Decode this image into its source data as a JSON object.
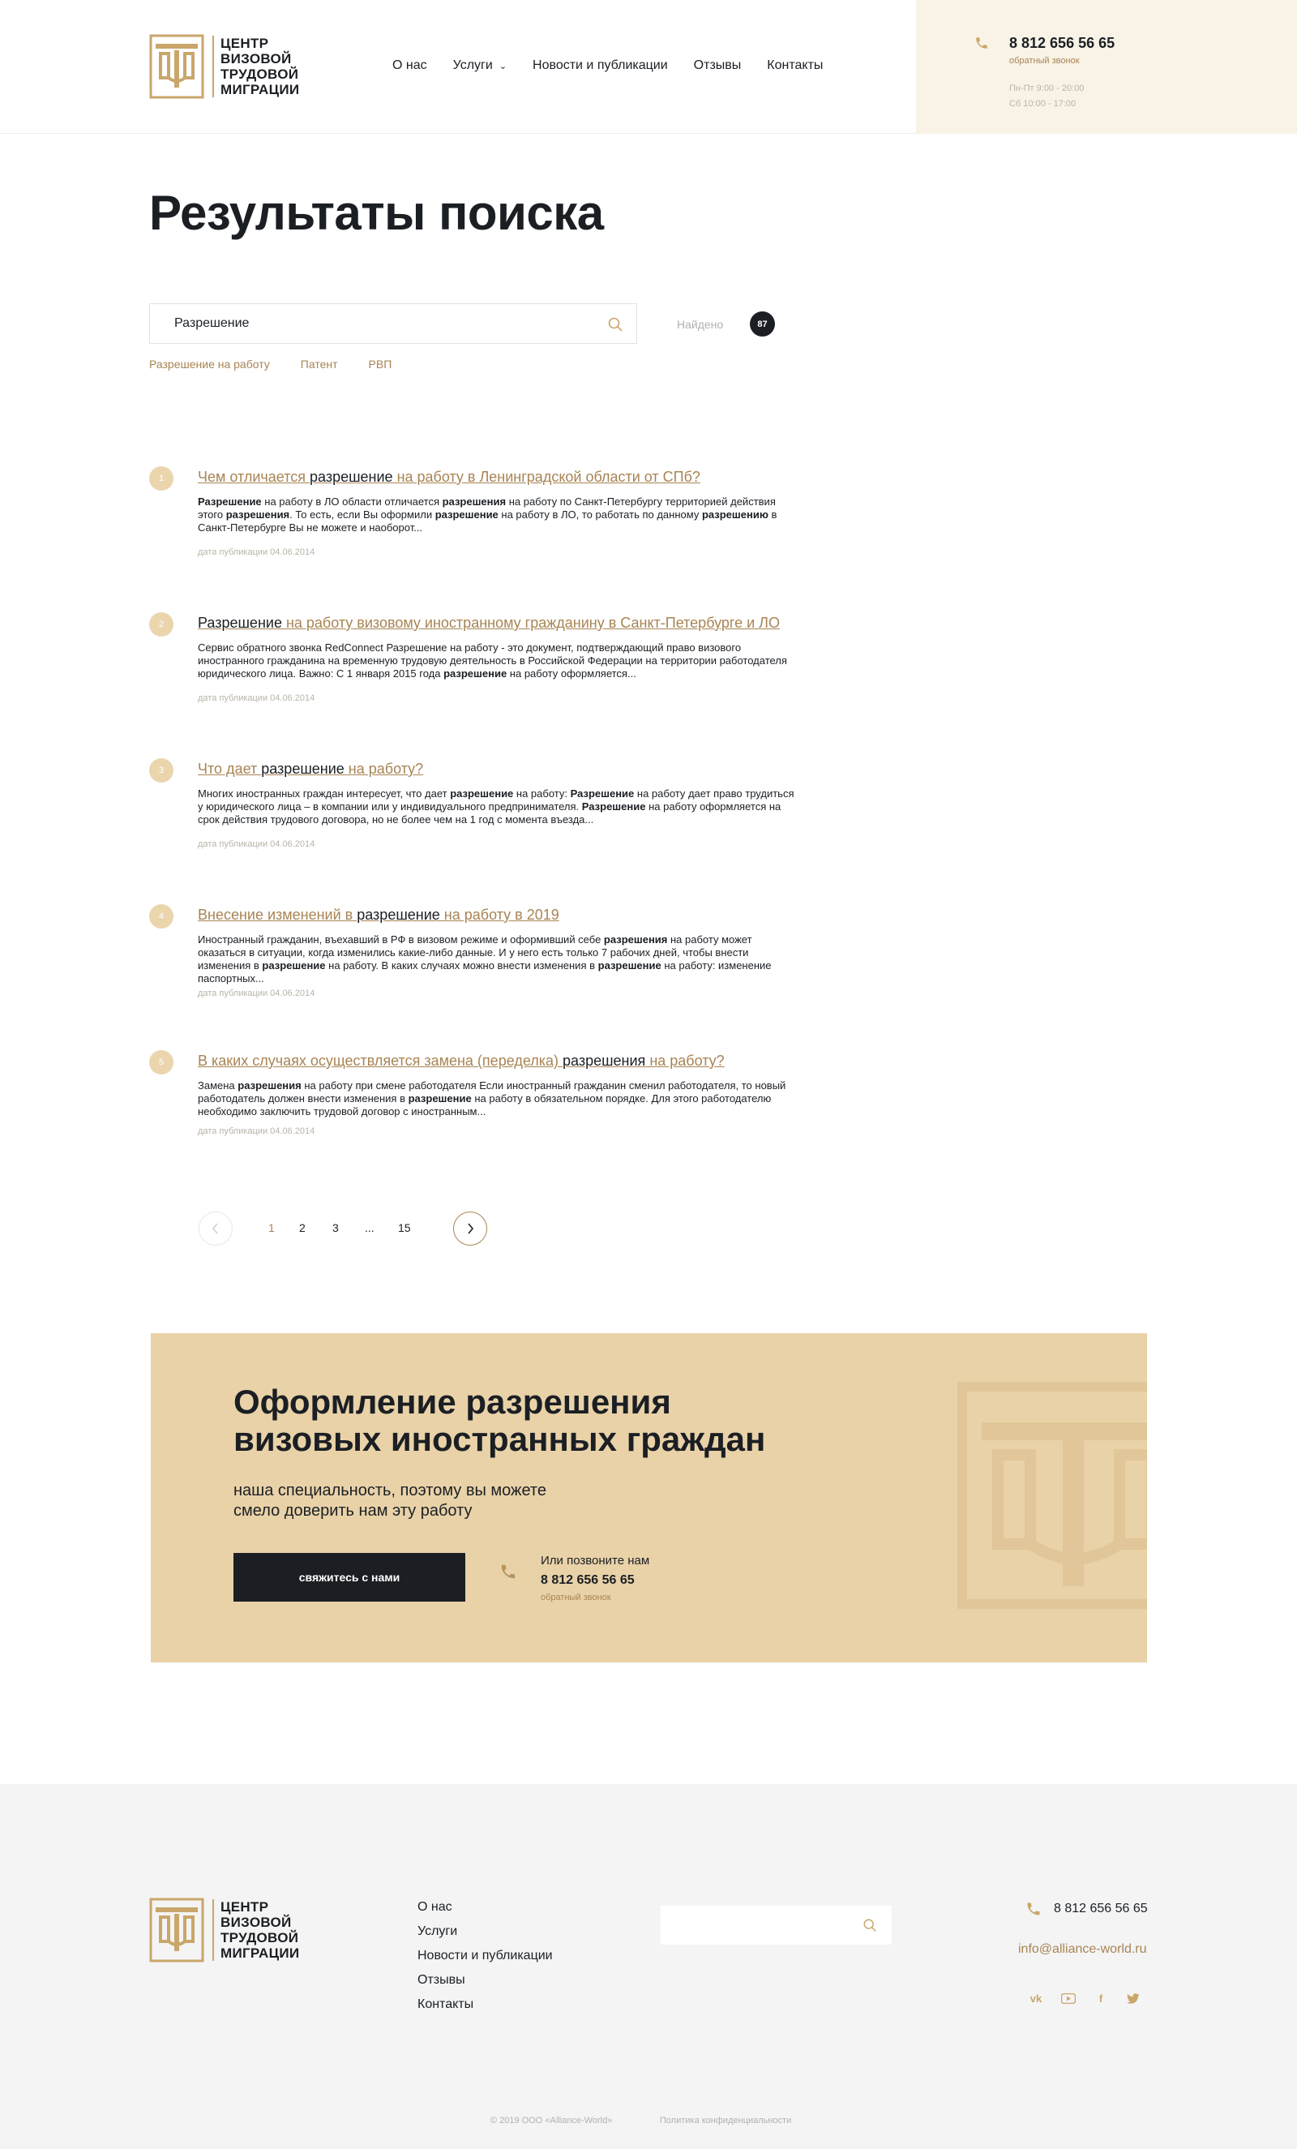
{
  "header": {
    "logo_lines": [
      "ЦЕНТР",
      "ВИЗОВОЙ",
      "ТРУДОВОЙ",
      "МИГРАЦИИ"
    ],
    "nav": [
      "О нас",
      "Услуги",
      "Новости и публикации",
      "Отзывы",
      "Контакты"
    ],
    "phone": "8 812 656 56 65",
    "callback": "обратный звонок",
    "hours": [
      "Пн-Пт 9:00 - 20:00",
      "Сб 10:00 - 17:00"
    ]
  },
  "page_title": "Результаты поиска",
  "search": {
    "value": "Разрешение",
    "found_label": "Найдено",
    "found_count": "87",
    "tags": [
      "Разрешение на работу",
      "Патент",
      "РВП"
    ]
  },
  "results": [
    {
      "num": "1",
      "title": [
        [
          "Чем отличается ",
          false
        ],
        [
          "разрешение",
          true
        ],
        [
          " на работу в Ленинградской области от СПб?",
          false
        ]
      ],
      "text": [
        [
          "Разрешение",
          true
        ],
        [
          " на работу в ЛО области отличается ",
          false
        ],
        [
          "разрешения",
          true
        ],
        [
          " на работу по Санкт-Петербургу территорией действия этого ",
          false
        ],
        [
          "разрешения",
          true
        ],
        [
          ". То есть, если Вы оформили ",
          false
        ],
        [
          "разрешение",
          true
        ],
        [
          " на работу в ЛО, то работать по данному ",
          false
        ],
        [
          "разрешению",
          true
        ],
        [
          " в Санкт-Петербурге Вы не можете и наоборот...",
          false
        ]
      ],
      "date": "дата публикации 04.06.2014"
    },
    {
      "num": "2",
      "title": [
        [
          "Разрешение",
          true
        ],
        [
          " на работу визовому иностранному гражданину в Санкт-Петербурге и ЛО",
          false
        ]
      ],
      "text": [
        [
          "Сервис обратного звонка RedConnect Разрешение на работу - это документ, подтверждающий право визового иностранного гражданина на временную трудовую деятельность в Российской Федерации на территории работодателя юридического лица. Важно: С 1 января 2015 года ",
          false
        ],
        [
          "разрешение",
          true
        ],
        [
          " на работу оформляется...",
          false
        ]
      ],
      "date": "дата публикации 04.06.2014"
    },
    {
      "num": "3",
      "title": [
        [
          "Что дает ",
          false
        ],
        [
          "разрешение",
          true
        ],
        [
          " на работу?",
          false
        ]
      ],
      "text": [
        [
          "Многих иностранных граждан интересует, что дает ",
          false
        ],
        [
          "разрешение",
          true
        ],
        [
          " на работу: ",
          false
        ],
        [
          "Разрешение",
          true
        ],
        [
          " на работу дает право трудиться у юридического лица – в компании или у индивидуального предпринимателя. ",
          false
        ],
        [
          "Разрешение",
          true
        ],
        [
          " на работу оформляется на срок действия трудового договора, но не более чем на 1 год с момента въезда...",
          false
        ]
      ],
      "date": "дата публикации 04.06.2014"
    },
    {
      "num": "4",
      "title": [
        [
          "Внесение изменений в ",
          false
        ],
        [
          "разрешение",
          true
        ],
        [
          " на работу в 2019",
          false
        ]
      ],
      "text": [
        [
          "Иностранный гражданин, въехавший в РФ в визовом режиме и оформивший себе ",
          false
        ],
        [
          "разрешения",
          true
        ],
        [
          " на работу может оказаться в ситуации, когда изменились какие-либо данные. И у него есть только 7 рабочих дней, чтобы внести изменения в ",
          false
        ],
        [
          "разрешение",
          true
        ],
        [
          " на работу. В каких случаях можно внести изменения в ",
          false
        ],
        [
          "разрешение",
          true
        ],
        [
          " на работу: изменение паспортных...",
          false
        ]
      ],
      "date": "дата публикации 04.06.2014"
    },
    {
      "num": "5",
      "title": [
        [
          "В каких случаях осуществляется замена (переделка) ",
          false
        ],
        [
          "разрешения",
          true
        ],
        [
          " на работу?",
          false
        ]
      ],
      "text": [
        [
          "Замена ",
          false
        ],
        [
          "разрешения",
          true
        ],
        [
          " на работу при смене работодателя Если иностранный гражданин сменил работодателя, то новый работодатель должен внести изменения в ",
          false
        ],
        [
          "разрешение",
          true
        ],
        [
          " на работу в обязательном порядке. Для этого работодателю необходимо заключить трудовой договор с иностранным...",
          false
        ]
      ],
      "date": "дата публикации 04.06.2014"
    }
  ],
  "pagination": {
    "pages": [
      "1",
      "2",
      "3",
      "...",
      "15"
    ],
    "active": "1"
  },
  "cta": {
    "title_lines": [
      "Оформление разрешения",
      "визовых иностранных граждан"
    ],
    "subtitle_lines": [
      "наша специальность, поэтому вы можете",
      "смело доверить нам эту работу"
    ],
    "button": "свяжитесь с нами",
    "call_label": "Или позвоните нам",
    "phone": "8 812 656 56 65",
    "callback": "обратный звонок"
  },
  "footer": {
    "nav": [
      "О нас",
      "Услуги",
      "Новости и публикации",
      "Отзывы",
      "Контакты"
    ],
    "search_placeholder": "",
    "phone": "8 812 656 56 65",
    "email": "info@alliance-world.ru",
    "socials": [
      "vk-icon",
      "youtube-icon",
      "facebook-icon",
      "twitter-icon"
    ],
    "copyright": "© 2019 ООО «Alliance-World»",
    "privacy": "Политика конфиденциальности"
  },
  "colors": {
    "accent": "#a88454",
    "cta_bg": "#e9d2a8",
    "contact_bg": "#f8f3e6",
    "dark": "#1b1f24",
    "footer_bg": "#f4f4f4"
  }
}
